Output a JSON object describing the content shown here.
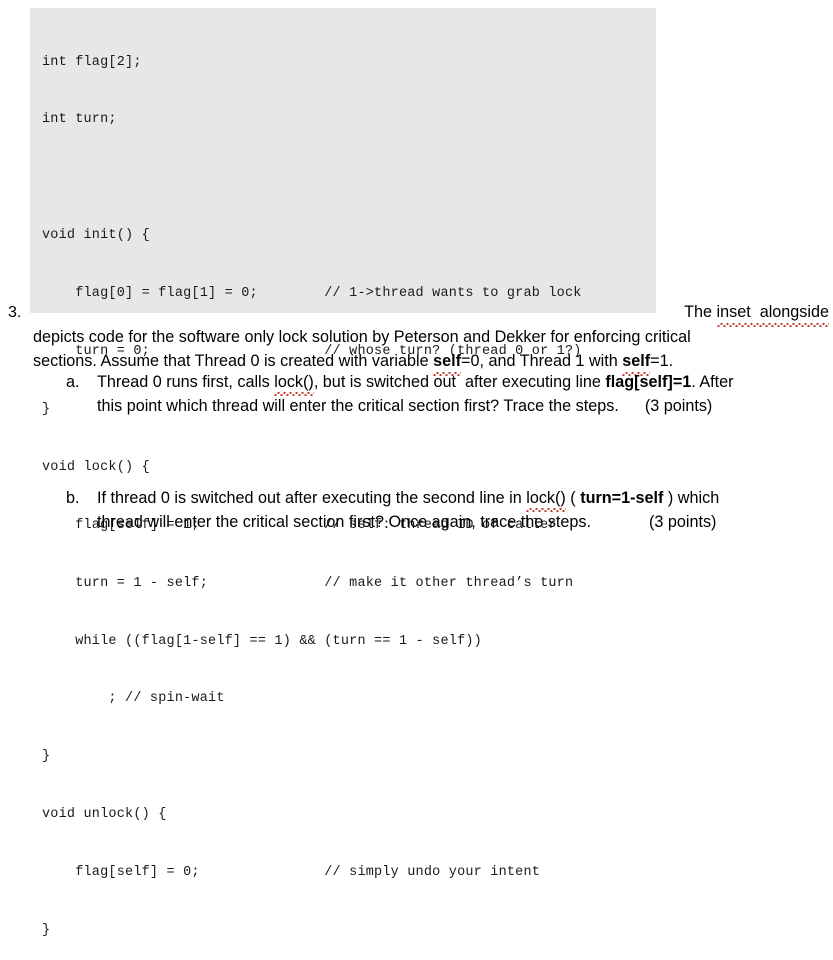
{
  "code_inset": {
    "background_color": "#e7e7e7",
    "lines": [
      "int flag[2];",
      "int turn;",
      "",
      "void init() {",
      "    flag[0] = flag[1] = 0;        // 1->thread wants to grab lock",
      "    turn = 0;                     // whose turn? (thread 0 or 1?)",
      "}",
      "void lock() {",
      "    flag[self] = 1;               // self: thread ID of caller",
      "    turn = 1 - self;              // make it other thread’s turn",
      "    while ((flag[1-self] == 1) && (turn == 1 - self))",
      "        ; // spin-wait",
      "}",
      "void unlock() {",
      "    flag[self] = 0;               // simply undo your intent",
      "}"
    ]
  },
  "question": {
    "number": "3.",
    "line1_tail": "The ",
    "line1_spell": "inset  alongside",
    "line2": "depicts code for the software only lock solution by Peterson and Dekker for enforcing critical",
    "line3_a": "sections. Assume that Thread 0 is created with variable ",
    "line3_self1": "self",
    "line3_b": "=0, and Thread 1 with ",
    "line3_self2": "self",
    "line3_c": "=1."
  },
  "sub_items": [
    {
      "marker": "a.",
      "line1_a": "Thread 0 runs first, calls ",
      "line1_lock": "lock()",
      "line1_b": ", but is switched out  after executing line ",
      "line1_bold": "flag[self]=1",
      "line1_c": ". After",
      "line2_a": "this point which thread will enter the critical section first? Trace the steps.",
      "line2_points": "(3 points)"
    },
    {
      "marker": "b.",
      "line1_a": "If thread 0 is switched out after executing the second line in ",
      "line1_lock": "lock()",
      "line1_b": " ( ",
      "line1_bold": "turn=1-self",
      "line1_c": " ) which",
      "line2_a": "thread will enter the critical section first? Once again, trace the steps.",
      "line2_points": "(3 points)"
    }
  ]
}
